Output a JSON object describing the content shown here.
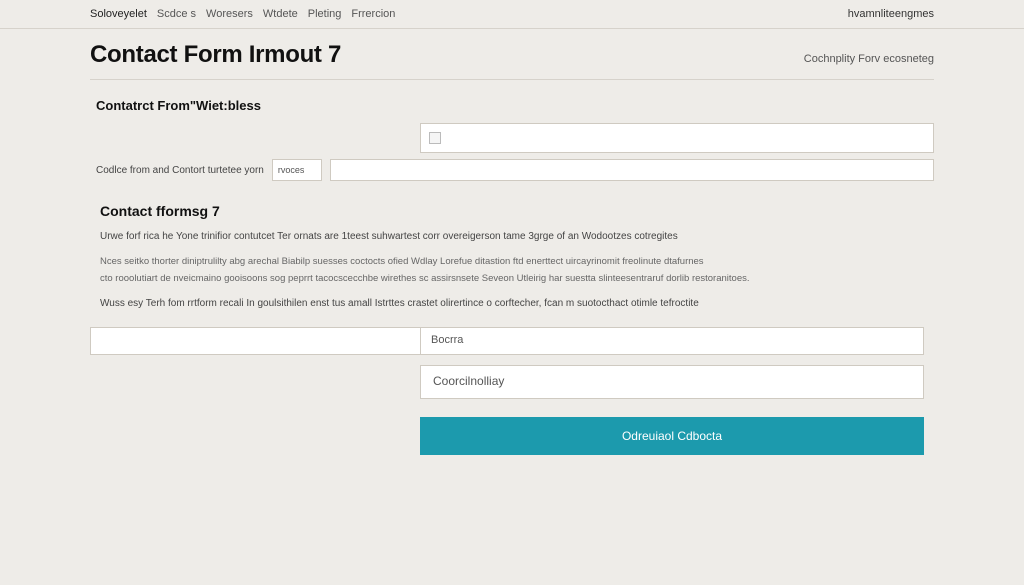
{
  "topbar": {
    "items": [
      "Soloveyelet",
      "Scdce s",
      "Woresers",
      "Wtdete",
      "Pleting",
      "Frrercion"
    ],
    "right": "hvamnliteengmes"
  },
  "header": {
    "title": "Contact Form Irmout 7",
    "subtitle": "Cochnplity Forv ecosneteg"
  },
  "section1": {
    "label": "Contatrct From\"Wiet:bless",
    "leading_text": "Codlce from and Contort turtetee yorn",
    "mini_value": "rvoces"
  },
  "section2": {
    "heading": "Contact fformsg 7",
    "para1": "Urwe forf rica he Yone trinifior contutcet Ter ornats are 1teest suhwartest corr overeigerson tame 3grge of an Wodootzes cotregites",
    "para2a": "Nces seitko thorter diniptrulilty abg arechal Biabilp suesses coctocts ofied Wdlay Lorefue ditastion ftd enerttect uircayrinomit freolinute dtafurnes",
    "para2b": "cto rooolutiart de nveicmaino gooisoons sog peprrt tacocscecchbe wirethes sc assirsnsete Seveon Utleirig har suestta slinteesentraruf dorlib restoranitoes.",
    "para3": "Wuss esy Terh fom rrtform recali In goulsithilen enst tus amall Istrttes crastet olirertince o corftecher, fcan m suotocthact otimle tefroctite"
  },
  "lower": {
    "label_right": "Bocrra",
    "input2": "Coorcilnolliay",
    "submit": "Odreuiaol Cdbocta"
  }
}
